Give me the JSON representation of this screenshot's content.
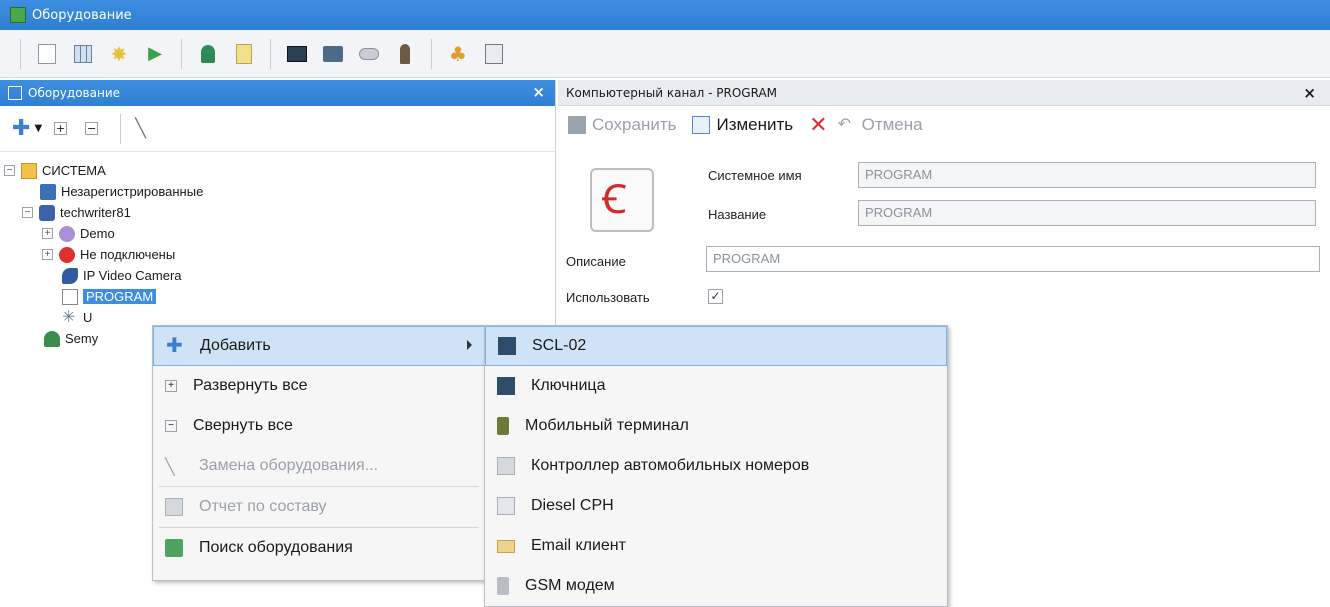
{
  "window": {
    "title": "Оборудование"
  },
  "left_panel": {
    "title": "Оборудование"
  },
  "tree": {
    "root": "СИСТЕМА",
    "unregistered": "Незарегистрированные",
    "server": "techwriter81",
    "demo": "Demo",
    "not_connected": "Не подключены",
    "ip_camera": "IP Video Camera",
    "program": "PROGRAM",
    "usb": "U",
    "semyo": "Semy"
  },
  "right_panel": {
    "title": "Компьютерный канал - PROGRAM",
    "save": "Сохранить",
    "edit": "Изменить",
    "cancel": "Отмена",
    "system_name_label": "Системное имя",
    "system_name_value": "PROGRAM",
    "name_label": "Название",
    "name_value": "PROGRAM",
    "description_label": "Описание",
    "description_value": "PROGRAM",
    "use_label": "Использовать"
  },
  "context_menu": {
    "add": "Добавить",
    "expand_all": "Развернуть все",
    "collapse_all": "Свернуть все",
    "replace_equipment": "Замена оборудования...",
    "report": "Отчет по составу",
    "search_equipment": "Поиск оборудования"
  },
  "submenu": [
    {
      "label": "SCL-02"
    },
    {
      "label": "Ключница"
    },
    {
      "label": "Мобильный терминал"
    },
    {
      "label": "Контроллер автомобильных номеров"
    },
    {
      "label": "Diesel CPH"
    },
    {
      "label": "Email клиент"
    },
    {
      "label": "GSM модем"
    }
  ],
  "colors": {
    "accent": "#2f7fd3",
    "highlight": "#cfe3f7",
    "danger": "#e03030"
  }
}
